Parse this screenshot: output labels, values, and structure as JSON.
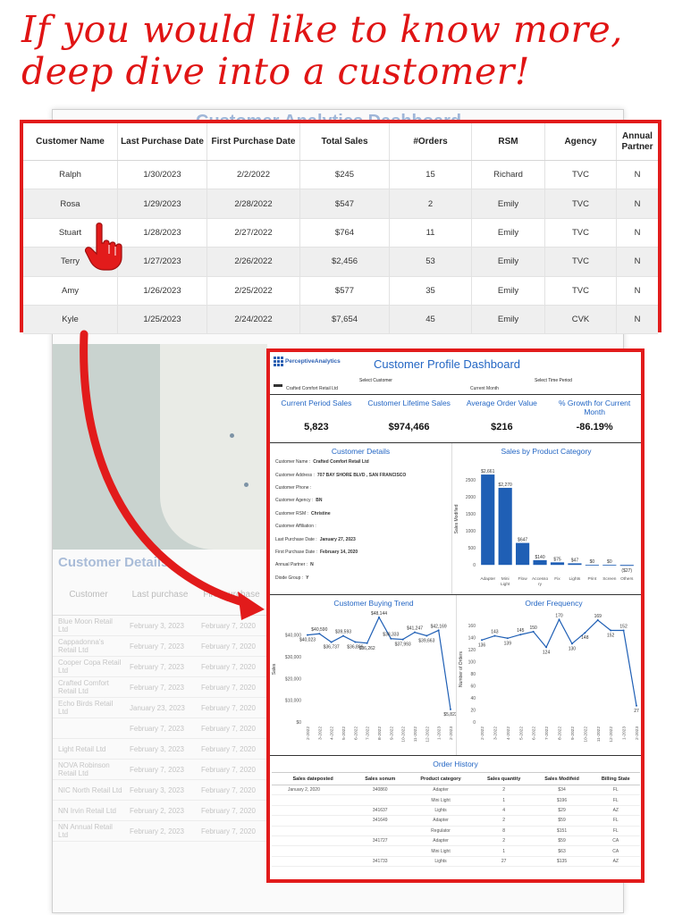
{
  "headline": {
    "line1": "If you would like to know more,",
    "line2": "deep dive into a customer!"
  },
  "background": {
    "title": "Customer Analytics Dashboard",
    "details_title": "Customer Details",
    "table_headers": [
      "Customer",
      "Last purchase",
      "First purchase"
    ],
    "rows": [
      [
        "Blue Moon Retail Ltd",
        "February 3, 2023",
        "February 7, 2020"
      ],
      [
        "Cappadonna's Retail Ltd",
        "February 7, 2023",
        "February 7, 2020"
      ],
      [
        "Cooper Copa Retail Ltd",
        "February 7, 2023",
        "February 7, 2020"
      ],
      [
        "Crafted Comfort Retail Ltd",
        "February 7, 2023",
        "February 7, 2020"
      ],
      [
        "Echo Birds Retail Ltd",
        "January 23, 2023",
        "February 7, 2020"
      ],
      [
        "",
        "February 7, 2023",
        "February 7, 2020"
      ],
      [
        "Light Retail Ltd",
        "February 3, 2023",
        "February 7, 2020"
      ],
      [
        "NOVA Robinson Retail Ltd",
        "February 7, 2023",
        "February 7, 2020"
      ],
      [
        "NIC North Retail Ltd",
        "February 3, 2023",
        "February 7, 2020"
      ],
      [
        "NN Irvin Retail Ltd",
        "February 2, 2023",
        "February 7, 2020"
      ],
      [
        "NN Annual Retail Ltd",
        "February 2, 2023",
        "February 7, 2020"
      ]
    ]
  },
  "customer_table": {
    "headers": [
      "Customer Name",
      "Last Purchase Date",
      "First Purchase Date",
      "Total Sales",
      "#Orders",
      "RSM",
      "Agency",
      "Annual Partner"
    ],
    "rows": [
      [
        "Ralph",
        "1/30/2023",
        "2/2/2022",
        "$245",
        "15",
        "Richard",
        "TVC",
        "N"
      ],
      [
        "Rosa",
        "1/29/2023",
        "2/28/2022",
        "$547",
        "2",
        "Emily",
        "TVC",
        "N"
      ],
      [
        "Stuart",
        "1/28/2023",
        "2/27/2022",
        "$764",
        "11",
        "Emily",
        "TVC",
        "N"
      ],
      [
        "Terry",
        "1/27/2023",
        "2/26/2022",
        "$2,456",
        "53",
        "Emily",
        "TVC",
        "N"
      ],
      [
        "Amy",
        "1/26/2023",
        "2/25/2022",
        "$577",
        "35",
        "Emily",
        "TVC",
        "N"
      ],
      [
        "Kyle",
        "1/25/2023",
        "2/24/2022",
        "$7,654",
        "45",
        "Emily",
        "CVK",
        "N"
      ]
    ]
  },
  "profile": {
    "logo": "PerceptiveAnalytics",
    "title": "Customer Profile Dashboard",
    "select_customer_label": "Select Customer",
    "select_customer_value": "Crafted Comfort Retail Ltd",
    "select_period_label": "Select Time Period",
    "select_period_value": "Current Month",
    "kpis": [
      {
        "label": "Current Period Sales",
        "value": "5,823"
      },
      {
        "label": "Customer Lifetime Sales",
        "value": "$974,466"
      },
      {
        "label": "Average Order Value",
        "value": "$216"
      },
      {
        "label": "% Growth for Current Month",
        "value": "-86.19%"
      }
    ],
    "details_title": "Customer Details",
    "details": [
      {
        "label": "Customer Name :",
        "value": "Crafted Comfort Retail Ltd"
      },
      {
        "label": "Customer Address :",
        "value": "707 BAY SHORE BLVD , SAN FRANCISCO"
      },
      {
        "label": "Customer Phone :",
        "value": ""
      },
      {
        "label": "Customer Agency :",
        "value": "BN"
      },
      {
        "label": "Customer RSM :",
        "value": "Christine"
      },
      {
        "label": "Customer Affiliation :",
        "value": ""
      },
      {
        "label": "Last Purchase Date :",
        "value": "January 27, 2023"
      },
      {
        "label": "First Purchase Date :",
        "value": "February 14, 2020"
      },
      {
        "label": "Annual Partner :",
        "value": "N"
      },
      {
        "label": "Diode Group :",
        "value": "Y"
      }
    ],
    "order_history": {
      "title": "Order History",
      "headers": [
        "Sales dateposted",
        "Sales sonum",
        "Product category",
        "Sales quantity",
        "Sales Modifeid",
        "Billing State"
      ],
      "rows": [
        [
          "January 2, 2020",
          "340860",
          "Adapter",
          "2",
          "$34",
          "FL"
        ],
        [
          "",
          "",
          "Mini Light",
          "1",
          "$196",
          "FL"
        ],
        [
          "",
          "341637",
          "Lights",
          "4",
          "$29",
          "AZ"
        ],
        [
          "",
          "341649",
          "Adapter",
          "2",
          "$59",
          "FL"
        ],
        [
          "",
          "",
          "Regulator",
          "8",
          "$151",
          "FL"
        ],
        [
          "",
          "341727",
          "Adapter",
          "2",
          "$59",
          "CA"
        ],
        [
          "",
          "",
          "Mini Light",
          "1",
          "$63",
          "CA"
        ],
        [
          "",
          "341733",
          "Lights",
          "27",
          "$135",
          "AZ"
        ]
      ]
    }
  },
  "chart_data": [
    {
      "type": "bar",
      "title": "Sales by Product Category",
      "ylabel": "Sales Modified",
      "categories": [
        "Adapter",
        "Mini Light",
        "Flow",
        "Accesso ry",
        "Fix",
        "Lights",
        "Print",
        "Screen",
        "Others"
      ],
      "values": [
        2661,
        2270,
        647,
        140,
        75,
        47,
        0,
        0,
        -27
      ],
      "labels": [
        "$2,661",
        "$2,270",
        "$647",
        "$140",
        "$75",
        "$47",
        "$0",
        "$0",
        "($27)"
      ],
      "yticks": [
        0,
        500,
        1000,
        1500,
        2000,
        2500
      ],
      "ylim": [
        -100,
        2900
      ],
      "color": "#1f5fb5"
    },
    {
      "type": "line",
      "title": "Customer Buying Trend",
      "ylabel": "Sales",
      "x": [
        "2-2022",
        "3-2022",
        "4-2022",
        "5-2022",
        "6-2022",
        "7-2022",
        "8-2022",
        "9-2022",
        "10-2022",
        "11-2022",
        "12-2022",
        "1-2023",
        "2-2023"
      ],
      "values": [
        40023,
        40590,
        36737,
        39593,
        36806,
        36262,
        48144,
        38333,
        37993,
        41247,
        39663,
        42169,
        5823
      ],
      "labels": [
        "$40,023",
        "$40,590",
        "$36,737",
        "$39,593",
        "$36,806",
        "$36,262",
        "$48,144",
        "$38,333",
        "$37,993",
        "$41,247",
        "$39,663",
        "$42,169",
        "$5,823"
      ],
      "label_pos": [
        "below",
        "above",
        "below",
        "above",
        "below",
        "below",
        "above",
        "above",
        "below",
        "above",
        "below",
        "above",
        "below"
      ],
      "yticks": [
        0,
        10000,
        20000,
        30000,
        40000
      ],
      "ytick_labels": [
        "$0",
        "$10,000",
        "$20,000",
        "$30,000",
        "$40,000"
      ],
      "ylim": [
        0,
        48500
      ],
      "color": "#1f5fb5"
    },
    {
      "type": "line",
      "title": "Order Frequency",
      "ylabel": "Number of Orders",
      "x": [
        "2-2022",
        "3-2022",
        "4-2022",
        "5-2022",
        "6-2022",
        "7-2022",
        "8-2022",
        "9-2022",
        "10-2022",
        "11-2022",
        "12-2022",
        "1-2023",
        "2-2023"
      ],
      "values": [
        136,
        143,
        139,
        145,
        150,
        124,
        170,
        130,
        148,
        169,
        152,
        152,
        27
      ],
      "labels": [
        "136",
        "143",
        "139",
        "145",
        "150",
        "124",
        "170",
        "130",
        "148",
        "169",
        "152",
        "152",
        "27"
      ],
      "label_pos": [
        "below",
        "above",
        "below",
        "above",
        "above",
        "below",
        "above",
        "below",
        "below",
        "above",
        "below",
        "above",
        "below"
      ],
      "yticks": [
        0,
        20,
        40,
        60,
        80,
        100,
        120,
        140,
        160
      ],
      "ytick_labels": [
        "0",
        "20",
        "40",
        "60",
        "80",
        "100",
        "120",
        "140",
        "160"
      ],
      "ylim": [
        0,
        175
      ],
      "color": "#1f5fb5"
    }
  ]
}
